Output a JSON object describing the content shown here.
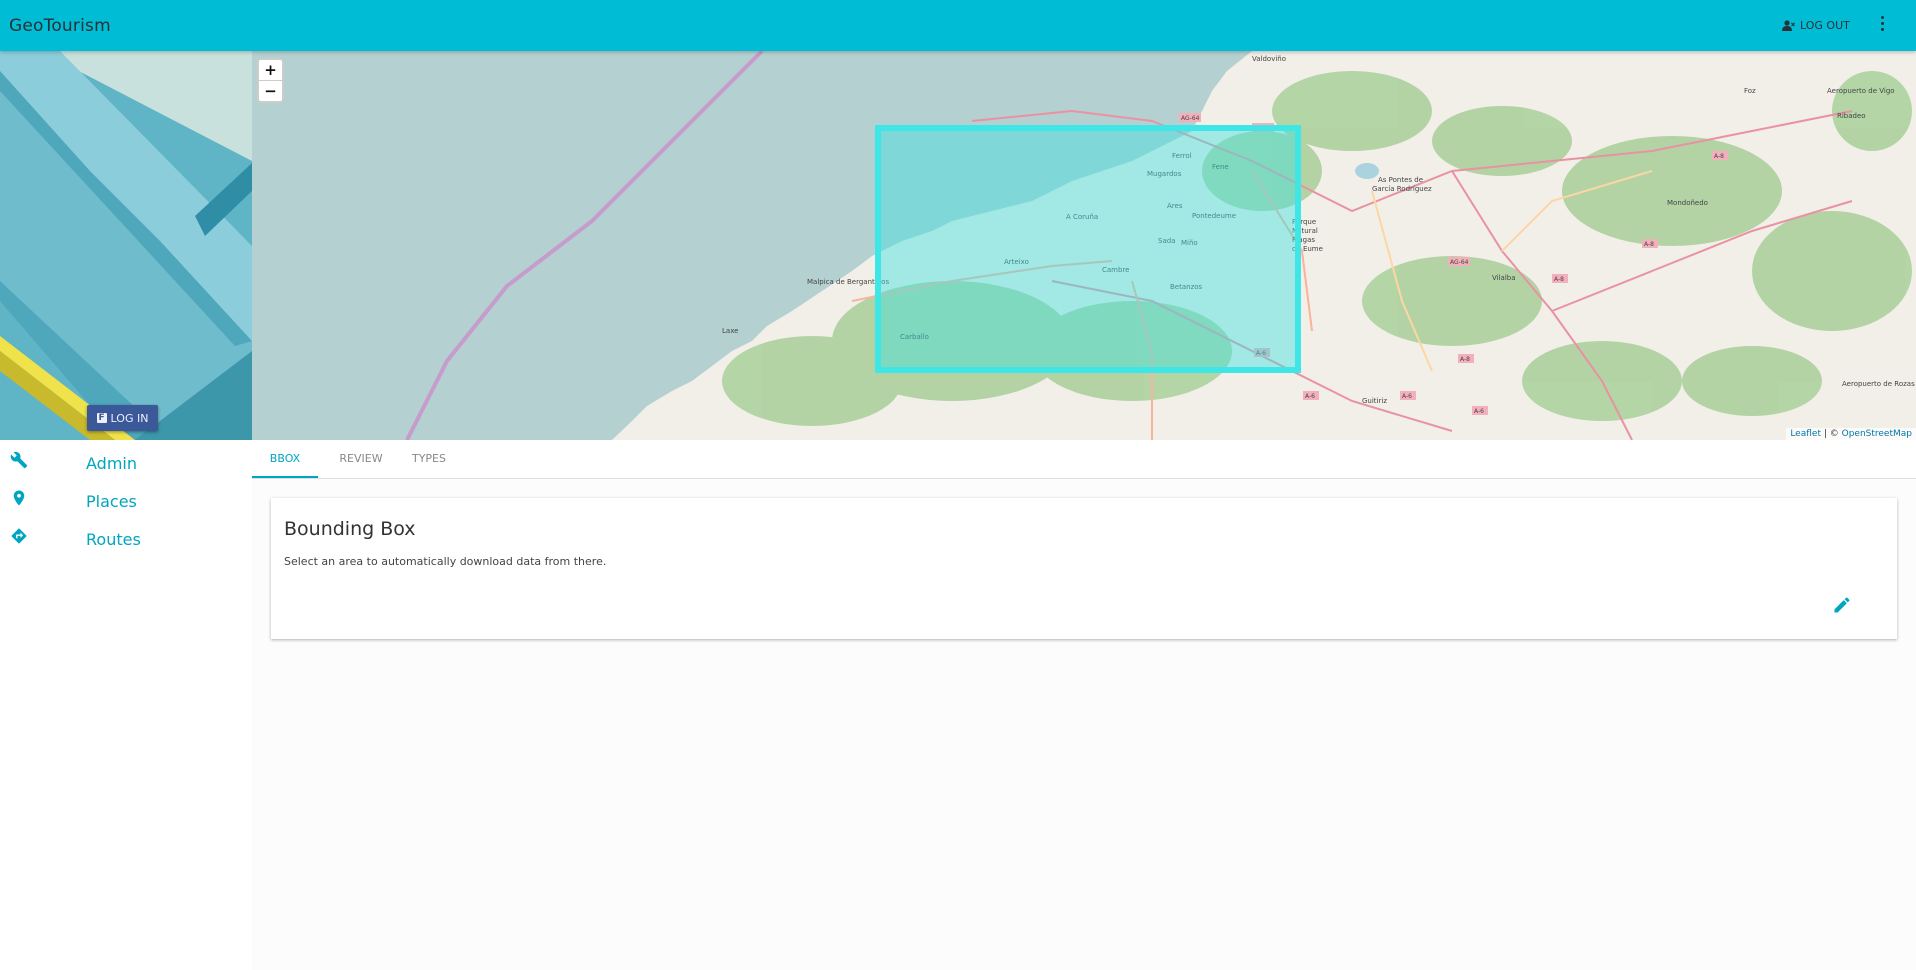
{
  "app": {
    "title": "GeoTourism"
  },
  "header": {
    "logout_label": "LOG OUT"
  },
  "sidebar": {
    "login_label": "LOG IN",
    "items": [
      {
        "label": "Admin",
        "icon": "wrench-icon"
      },
      {
        "label": "Places",
        "icon": "map-marker-icon"
      },
      {
        "label": "Routes",
        "icon": "directions-icon"
      }
    ]
  },
  "map": {
    "zoom_in": "+",
    "zoom_out": "−",
    "attribution_leaflet": "Leaflet",
    "attribution_sep": " | © ",
    "attribution_osm": "OpenStreetMap",
    "labels": [
      "Valdoviño",
      "Ferrol",
      "Mugardos",
      "Ares",
      "Fene",
      "Pontedeume",
      "A Coruña",
      "Sada",
      "Miño",
      "Arteixo",
      "Cambre",
      "Betanzos",
      "Malpica de Bergantiños",
      "Carballo",
      "Laxe",
      "As Pontes de García Rodríguez",
      "Parque Natural Fragas do Eume",
      "Vilalba",
      "Mondoñedo",
      "Foz",
      "Ribadeo",
      "Guitiriz",
      "Aeropuerto de Vigo",
      "Aeropuerto de Rozas"
    ],
    "road_labels": [
      "AG-64",
      "AG-64",
      "A-8",
      "A-8",
      "AG-64",
      "A-8",
      "A-8",
      "A-6",
      "A-6",
      "A-6",
      "A-6",
      "A-8"
    ],
    "colors": {
      "water": "#b5d0d0",
      "land": "#f2efe9",
      "forest": "#add19e",
      "bbox": "#3ee6e6"
    }
  },
  "tabs": [
    {
      "label": "BBOX",
      "active": true
    },
    {
      "label": "REVIEW",
      "active": false
    },
    {
      "label": "TYPES",
      "active": false
    }
  ],
  "card": {
    "title": "Bounding Box",
    "description": "Select an area to automatically download data from there."
  },
  "colors": {
    "primary": "#00bcd4",
    "accent": "#00a6bf",
    "facebook": "#3b5998"
  }
}
